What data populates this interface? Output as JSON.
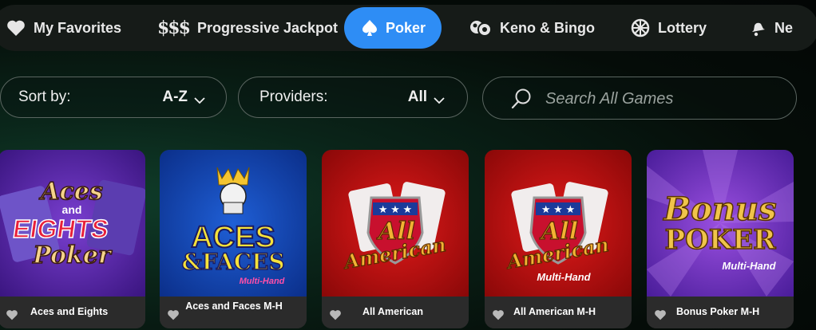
{
  "categories": [
    {
      "label": "My Favorites",
      "icon": "heart-icon",
      "active": false
    },
    {
      "label": "Progressive Jackpot",
      "icon": "dollar-signs-icon",
      "active": false
    },
    {
      "label": "Poker",
      "icon": "spade-icon",
      "active": true
    },
    {
      "label": "Keno & Bingo",
      "icon": "bingo-balls-icon",
      "active": false
    },
    {
      "label": "Lottery",
      "icon": "lottery-wheel-icon",
      "active": false
    },
    {
      "label": "Ne",
      "icon": "bell-icon",
      "active": false
    }
  ],
  "filters": {
    "sort": {
      "label": "Sort by:",
      "value": "A-Z"
    },
    "providers": {
      "label": "Providers:",
      "value": "All"
    },
    "search_placeholder": "Search All Games"
  },
  "games": [
    {
      "name": "Aces and Eights",
      "art_text": [
        "Aces",
        "and",
        "EIGHTS",
        "Poker"
      ]
    },
    {
      "name": "Aces and Faces M-H",
      "art_text": [
        "ACES",
        "&FACES",
        "Multi-Hand"
      ]
    },
    {
      "name": "All American",
      "art_text": [
        "All",
        "American"
      ]
    },
    {
      "name": "All American M-H",
      "art_text": [
        "All",
        "American",
        "Multi-Hand"
      ]
    },
    {
      "name": "Bonus Poker M-H",
      "art_text": [
        "Bonus",
        "POKER",
        "Multi-Hand"
      ]
    }
  ],
  "colors": {
    "accent": "#2e8df5",
    "bar": "#161b18",
    "card_footer": "#2b2b2b"
  }
}
